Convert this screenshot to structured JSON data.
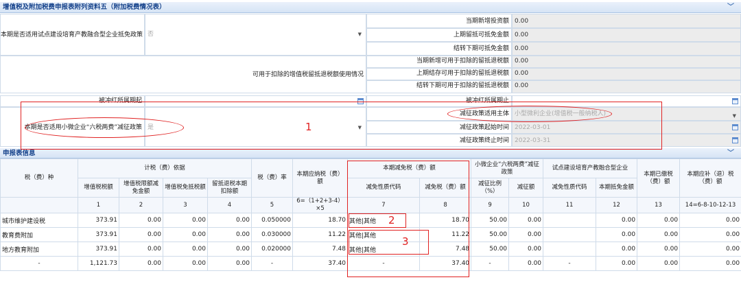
{
  "section1": {
    "title": "增值税及附加税费申报表附列资料五（附加税费情况表）",
    "pilot_label": "本期是否适用试点建设培育产教融合型企业抵免政策",
    "pilot_value": "否",
    "r1_label": "当期新增投资额",
    "r1_value": "0.00",
    "r2_label": "上期留抵可抵免金额",
    "r2_value": "0.00",
    "r3_label": "结转下期可抵免金额",
    "r3_value": "0.00",
    "refund_label": "可用于扣除的增值税留抵退税额使用情况",
    "r4_label": "当期新增可用于扣除的留抵退税额",
    "r4_value": "0.00",
    "r5_label": "上期结存可用于扣除的留抵退税额",
    "r5_value": "0.00",
    "r6_label": "结转下期可用于扣除的留抵退税额",
    "r6_value": "0.00",
    "cancel_left_label": "被冲红所属期起",
    "cancel_right_label": "被冲红所属期止",
    "six_label": "本期是否适用小微企业“六税两费”减征政策",
    "six_value": "是",
    "subject_label": "减征政策适用主体",
    "subject_value": "小型微利企业(增值税一般纳税人)",
    "start_label": "减征政策起始时间",
    "start_value": "2022-03-01",
    "end_label": "减征政策终止时间",
    "end_value": "2022-03-31"
  },
  "section2": {
    "title": "申报表信息"
  },
  "headers": {
    "tax_type": "税（费）种",
    "basis": "计税（费）依据",
    "vat": "增值税税额",
    "limit": "增值税限额减免金额",
    "exempt": "增值税免抵税额",
    "refund": "留抵退税本期扣除额",
    "rate": "税（费）率",
    "payable": "本期应纳税（费）额",
    "relief": "本期减免税（费）额",
    "relief_code": "减免性质代码",
    "relief_amt": "减免税（费）额",
    "small": "小微企业“六税两费”减征政策",
    "ratio": "减征比例（%）",
    "reduce": "减征额",
    "pilot": "试点建设培育产教融合型企业",
    "pilot_code": "减免性质代码",
    "pilot_amt": "本期抵免金额",
    "paid": "本期已缴税（费）额",
    "due": "本期应补（退）税（费）额"
  },
  "col_numbers": [
    "1",
    "2",
    "3",
    "4",
    "5",
    "6=（1+2+3-4）×5",
    "7",
    "8",
    "9",
    "10",
    "11",
    "12",
    "13",
    "14=6-8-10-12-13"
  ],
  "rows": [
    [
      "城市维护建设税",
      "373.91",
      "0.00",
      "0.00",
      "0.00",
      "0.050000",
      "18.70",
      "其他|其他",
      "18.70",
      "50.00",
      "0.00",
      "",
      "0.00",
      "0.00",
      "0.00"
    ],
    [
      "教育费附加",
      "373.91",
      "0.00",
      "0.00",
      "0.00",
      "0.030000",
      "11.22",
      "其他|其他",
      "11.22",
      "50.00",
      "0.00",
      "",
      "0.00",
      "0.00",
      "0.00"
    ],
    [
      "地方教育附加",
      "373.91",
      "0.00",
      "0.00",
      "0.00",
      "0.020000",
      "7.48",
      "其他|其他",
      "7.48",
      "50.00",
      "0.00",
      "",
      "0.00",
      "0.00",
      "0.00"
    ],
    [
      "-",
      "1,121.73",
      "0.00",
      "0.00",
      "0.00",
      "-",
      "37.40",
      "-",
      "37.40",
      "-",
      "0.00",
      "-",
      "0.00",
      "0.00",
      "0.00"
    ]
  ],
  "annotations": [
    "1",
    "2",
    "3"
  ]
}
